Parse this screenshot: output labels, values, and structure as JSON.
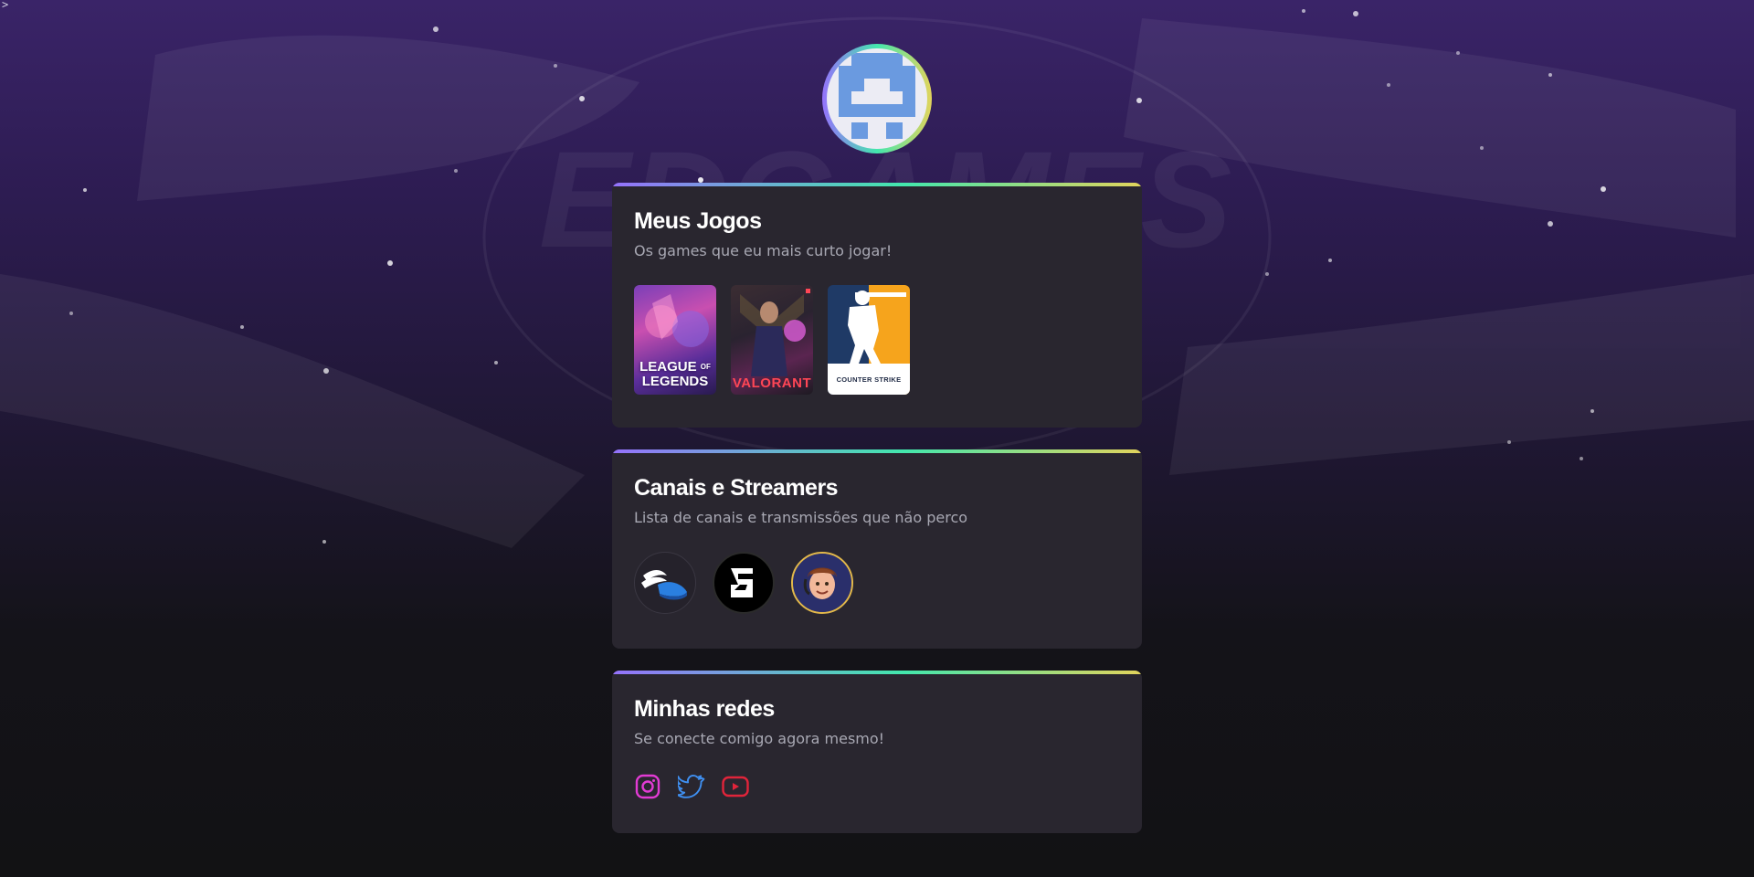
{
  "page": {
    "corner_glyph": ">",
    "colors": {
      "background_top": "#3a2468",
      "background_bottom": "#121214",
      "card": "#29262f",
      "gradient_start": "#9572fc",
      "gradient_mid": "#43e7ad",
      "gradient_end": "#e2d45c",
      "heading": "#ffffff",
      "subtext": "#a8a8b3"
    }
  },
  "profile": {
    "avatar_icon": "pixel-ghost-icon"
  },
  "games_card": {
    "title": "Meus Jogos",
    "subtitle": "Os games que eu mais curto jogar!",
    "games": [
      {
        "name": "League of Legends",
        "label_line1": "LEAGUE",
        "label_of": "OF",
        "label_line2": "LEGENDS"
      },
      {
        "name": "Valorant",
        "label": "VALORANT"
      },
      {
        "name": "Counter Strike",
        "label": "COUNTER STRIKE"
      }
    ]
  },
  "channels_card": {
    "title": "Canais e Streamers",
    "subtitle": "Lista de canais e transmissões que não perco",
    "channels": [
      {
        "icon": "winged-shoe-icon"
      },
      {
        "icon": "six-logo-icon"
      },
      {
        "icon": "streamer-avatar-icon"
      }
    ]
  },
  "socials_card": {
    "title": "Minhas redes",
    "subtitle": "Se conecte comigo agora mesmo!",
    "links": [
      {
        "icon": "instagram-icon",
        "color": "#e23bd4"
      },
      {
        "icon": "twitter-icon",
        "color": "#3f8ff0"
      },
      {
        "icon": "youtube-icon",
        "color": "#e0243a"
      }
    ]
  }
}
